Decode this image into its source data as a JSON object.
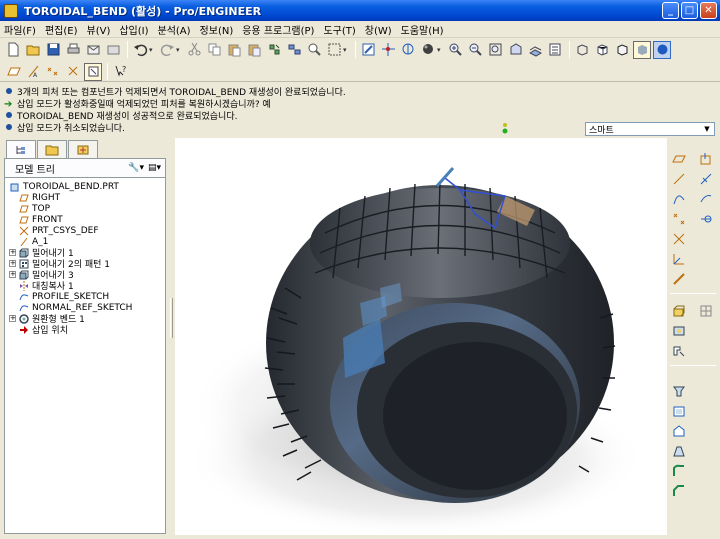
{
  "window": {
    "title": "TOROIDAL_BEND (활성) - Pro/ENGINEER"
  },
  "menu": [
    "파일(F)",
    "편집(E)",
    "뷰(V)",
    "삽입(I)",
    "분석(A)",
    "정보(N)",
    "응용 프로그램(P)",
    "도구(T)",
    "창(W)",
    "도움말(H)"
  ],
  "messages": [
    "3개의 피처 또는 컴포넌트가 억제되면서 TOROIDAL_BEND 재생성이 완료되었습니다.",
    "삽입 모드가 활성화중일때 억제되었던 피처를 복원하시겠습니까?   예",
    "TOROIDAL_BEND 재생성이 성공적으로 완료되었습니다.",
    "삽입 모드가 취소되었습니다."
  ],
  "filter": {
    "selected": "스마트"
  },
  "model_tree": {
    "title": "모델 트리",
    "items": [
      "TOROIDAL_BEND.PRT",
      "RIGHT",
      "TOP",
      "FRONT",
      "PRT_CSYS_DEF",
      "A_1",
      "밀어내기 1",
      "밀어내기 2의 패턴 1",
      "밀어내기 3",
      "대칭복사 1",
      "PROFILE_SKETCH",
      "NORMAL_REF_SKETCH",
      "원환형 벤드 1",
      "삽입 위치"
    ]
  },
  "colors": {
    "titlebar": "#0a5fe0",
    "tire": "#3a3f48",
    "highlight": "#4a7fb8",
    "insert_arrow": "#c00000"
  }
}
